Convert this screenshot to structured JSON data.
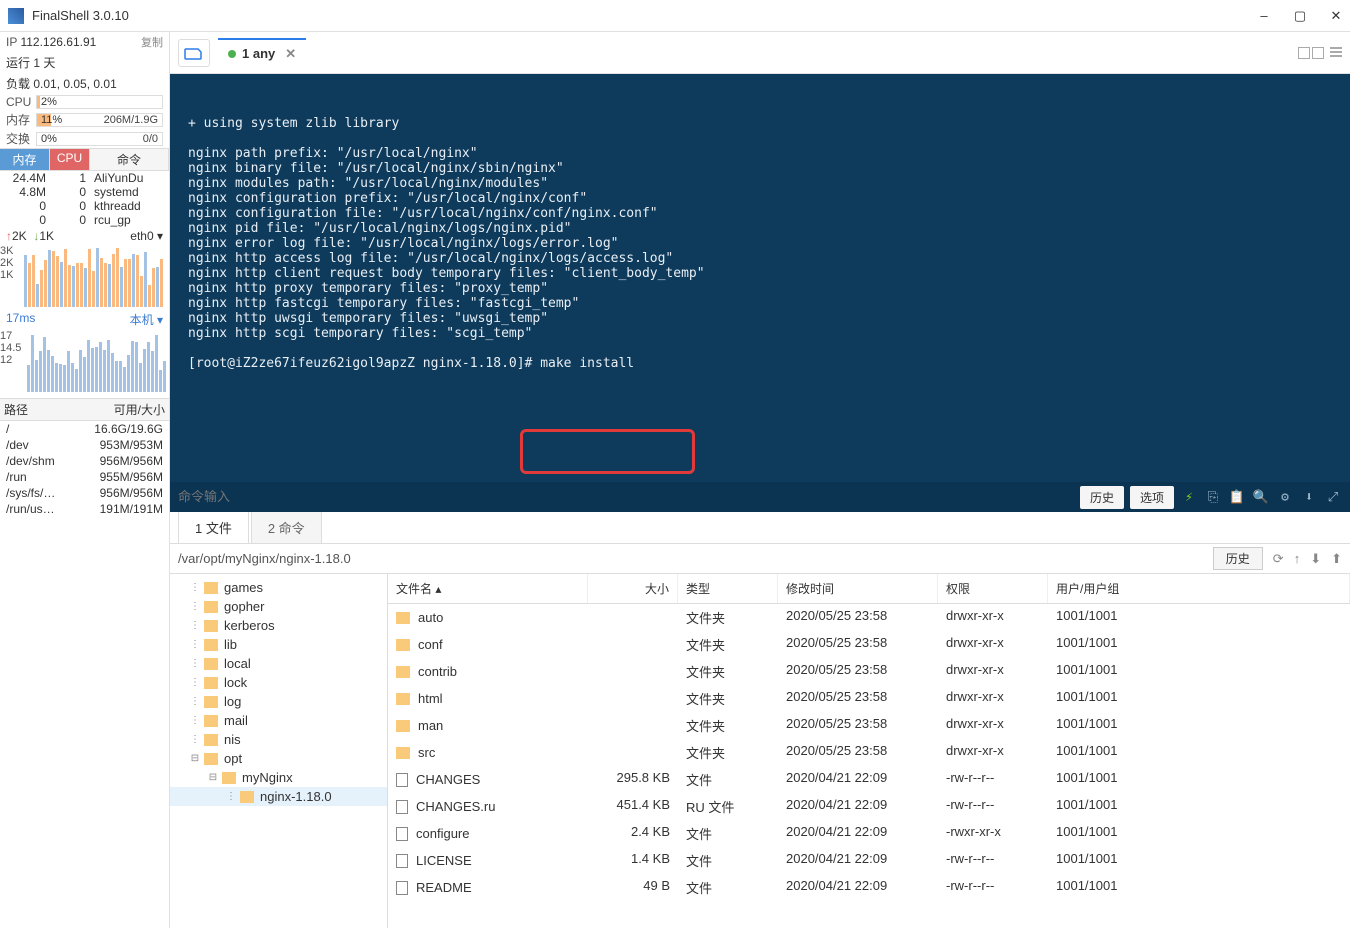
{
  "app": {
    "title": "FinalShell 3.0.10"
  },
  "win_controls": [
    "–",
    "▢",
    "✕"
  ],
  "side": {
    "ip_label": "IP",
    "ip": "112.126.61.91",
    "copy": "复制",
    "uptime": "运行 1 天",
    "load": "负载 0.01, 0.05, 0.01",
    "cpu": {
      "label": "CPU",
      "pct": "2%"
    },
    "mem": {
      "label": "内存",
      "pct": "11%",
      "rhs": "206M/1.9G"
    },
    "swap": {
      "label": "交换",
      "pct": "0%",
      "rhs": "0/0"
    },
    "proc_head": {
      "mem": "内存",
      "cpu": "CPU",
      "cmd": "命令"
    },
    "procs": [
      {
        "mem": "24.4M",
        "cpu": "1",
        "cmd": "AliYunDu"
      },
      {
        "mem": "4.8M",
        "cpu": "0",
        "cmd": "systemd"
      },
      {
        "mem": "0",
        "cpu": "0",
        "cmd": "kthreadd"
      },
      {
        "mem": "0",
        "cpu": "0",
        "cmd": "rcu_gp"
      }
    ],
    "net": {
      "up": "2K",
      "down": "1K",
      "iface": "eth0",
      "labels": [
        "3K",
        "2K",
        "1K"
      ]
    },
    "ping": {
      "ms": "17ms",
      "host": "本机",
      "labels": [
        "17",
        "14.5",
        "12"
      ]
    },
    "disk_head": {
      "path": "路径",
      "usage": "可用/大小"
    },
    "disks": [
      {
        "path": "/",
        "usage": "16.6G/19.6G"
      },
      {
        "path": "/dev",
        "usage": "953M/953M"
      },
      {
        "path": "/dev/shm",
        "usage": "956M/956M"
      },
      {
        "path": "/run",
        "usage": "955M/956M"
      },
      {
        "path": "/sys/fs/…",
        "usage": "956M/956M"
      },
      {
        "path": "/run/us…",
        "usage": "191M/191M"
      }
    ]
  },
  "tab": {
    "label": "1 any"
  },
  "terminal": {
    "lines": [
      "+ using system zlib library",
      "",
      "nginx path prefix: \"/usr/local/nginx\"",
      "nginx binary file: \"/usr/local/nginx/sbin/nginx\"",
      "nginx modules path: \"/usr/local/nginx/modules\"",
      "nginx configuration prefix: \"/usr/local/nginx/conf\"",
      "nginx configuration file: \"/usr/local/nginx/conf/nginx.conf\"",
      "nginx pid file: \"/usr/local/nginx/logs/nginx.pid\"",
      "nginx error log file: \"/usr/local/nginx/logs/error.log\"",
      "nginx http access log file: \"/usr/local/nginx/logs/access.log\"",
      "nginx http client request body temporary files: \"client_body_temp\"",
      "nginx http proxy temporary files: \"proxy_temp\"",
      "nginx http fastcgi temporary files: \"fastcgi_temp\"",
      "nginx http uwsgi temporary files: \"uwsgi_temp\"",
      "nginx http scgi temporary files: \"scgi_temp\"",
      "",
      "[root@iZ2ze67ifeuz62igol9apzZ nginx-1.18.0]# make install"
    ],
    "placeholder": "命令输入",
    "history_btn": "历史",
    "options_btn": "选项"
  },
  "bottom_tabs": {
    "t1": "1 文件",
    "t2": "2 命令"
  },
  "path": "/var/opt/myNginx/nginx-1.18.0",
  "path_history": "历史",
  "tree": [
    {
      "name": "games",
      "indent": 1
    },
    {
      "name": "gopher",
      "indent": 1
    },
    {
      "name": "kerberos",
      "indent": 1
    },
    {
      "name": "lib",
      "indent": 1
    },
    {
      "name": "local",
      "indent": 1
    },
    {
      "name": "lock",
      "indent": 1
    },
    {
      "name": "log",
      "indent": 1
    },
    {
      "name": "mail",
      "indent": 1
    },
    {
      "name": "nis",
      "indent": 1
    },
    {
      "name": "opt",
      "indent": 1,
      "exp": "⊟"
    },
    {
      "name": "myNginx",
      "indent": 2,
      "exp": "⊟"
    },
    {
      "name": "nginx-1.18.0",
      "indent": 3,
      "sel": true
    }
  ],
  "fl_head": {
    "name": "文件名 ▴",
    "size": "大小",
    "type": "类型",
    "date": "修改时间",
    "perm": "权限",
    "user": "用户/用户组"
  },
  "files": [
    {
      "ico": "folder",
      "name": "auto",
      "size": "",
      "type": "文件夹",
      "date": "2020/05/25 23:58",
      "perm": "drwxr-xr-x",
      "user": "1001/1001"
    },
    {
      "ico": "folder",
      "name": "conf",
      "size": "",
      "type": "文件夹",
      "date": "2020/05/25 23:58",
      "perm": "drwxr-xr-x",
      "user": "1001/1001"
    },
    {
      "ico": "folder",
      "name": "contrib",
      "size": "",
      "type": "文件夹",
      "date": "2020/05/25 23:58",
      "perm": "drwxr-xr-x",
      "user": "1001/1001"
    },
    {
      "ico": "folder",
      "name": "html",
      "size": "",
      "type": "文件夹",
      "date": "2020/05/25 23:58",
      "perm": "drwxr-xr-x",
      "user": "1001/1001"
    },
    {
      "ico": "folder",
      "name": "man",
      "size": "",
      "type": "文件夹",
      "date": "2020/05/25 23:58",
      "perm": "drwxr-xr-x",
      "user": "1001/1001"
    },
    {
      "ico": "folder",
      "name": "src",
      "size": "",
      "type": "文件夹",
      "date": "2020/05/25 23:58",
      "perm": "drwxr-xr-x",
      "user": "1001/1001"
    },
    {
      "ico": "file",
      "name": "CHANGES",
      "size": "295.8 KB",
      "type": "文件",
      "date": "2020/04/21 22:09",
      "perm": "-rw-r--r--",
      "user": "1001/1001"
    },
    {
      "ico": "file",
      "name": "CHANGES.ru",
      "size": "451.4 KB",
      "type": "RU 文件",
      "date": "2020/04/21 22:09",
      "perm": "-rw-r--r--",
      "user": "1001/1001"
    },
    {
      "ico": "file",
      "name": "configure",
      "size": "2.4 KB",
      "type": "文件",
      "date": "2020/04/21 22:09",
      "perm": "-rwxr-xr-x",
      "user": "1001/1001"
    },
    {
      "ico": "file",
      "name": "LICENSE",
      "size": "1.4 KB",
      "type": "文件",
      "date": "2020/04/21 22:09",
      "perm": "-rw-r--r--",
      "user": "1001/1001"
    },
    {
      "ico": "file",
      "name": "README",
      "size": "49 B",
      "type": "文件",
      "date": "2020/04/21 22:09",
      "perm": "-rw-r--r--",
      "user": "1001/1001"
    }
  ]
}
